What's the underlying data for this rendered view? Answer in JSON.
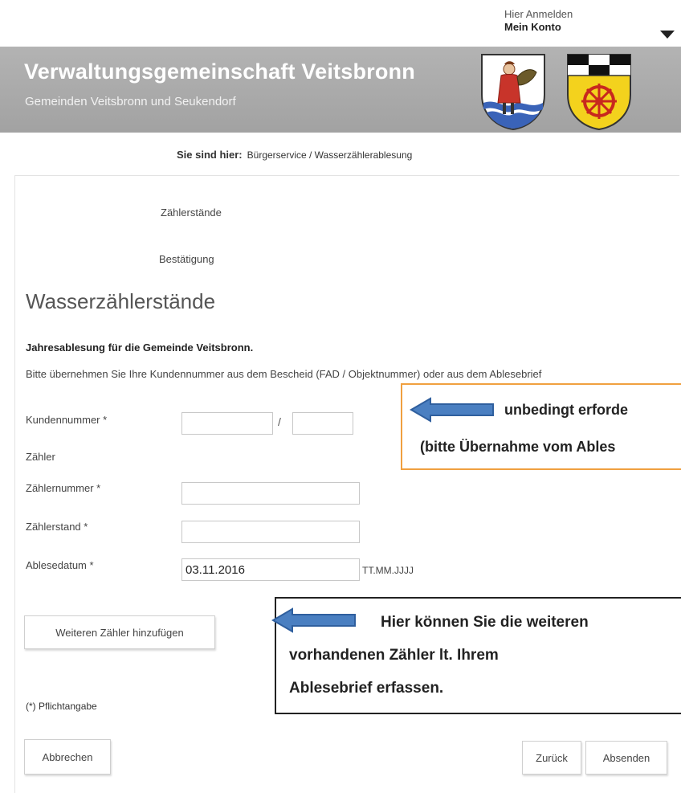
{
  "account": {
    "login_label": "Hier Anmelden",
    "konto_label": "Mein Konto"
  },
  "banner": {
    "title": "Verwaltungsgemeinschaft Veitsbronn",
    "subtitle": "Gemeinden Veitsbronn und Seukendorf"
  },
  "breadcrumb": {
    "label": "Sie sind hier:",
    "path": "Bürgerservice / Wasserzählerablesung"
  },
  "steps": [
    "Zählerstände",
    "Bestätigung"
  ],
  "form": {
    "title": "Wasserzählerstände",
    "subtitle": "Jahresablesung für die Gemeinde Veitsbronn.",
    "instructions": "Bitte übernehmen Sie Ihre Kundennummer aus dem Bescheid (FAD / Objektnummer) oder aus dem Ablesebrief",
    "kundennummer_label": "Kundennummer *",
    "kundennummer_separator": "/",
    "kundennummer_part1": "",
    "kundennummer_part2": "",
    "zaehler_section": "Zähler",
    "zaehlernummer_label": "Zählernummer *",
    "zaehlernummer_value": "",
    "zaehlerstand_label": "Zählerstand *",
    "zaehlerstand_value": "",
    "ablesedatum_label": "Ablesedatum *",
    "ablesedatum_value": "03.11.2016",
    "ablesedatum_hint": "TT.MM.JJJJ",
    "add_meter_button": "Weiteren Zähler hinzufügen",
    "required_note": "(*) Pflichtangabe",
    "cancel_button": "Abbrechen",
    "back_button": "Zurück",
    "submit_button": "Absenden"
  },
  "annotations": {
    "note1_line1": "unbedingt erforde",
    "note1_line2": "(bitte Übernahme vom Ables",
    "note2_line1": "Hier können Sie die weiteren",
    "note2_line2": "vorhandenen Zähler lt. Ihrem",
    "note2_line3": "Ablesebrief erfassen."
  },
  "colors": {
    "banner": "#a9a9a9",
    "arrow": "#4a7fc1",
    "note_orange": "#f0a040"
  },
  "icons": {
    "account_caret": "caret-down-icon",
    "crest_veitsbronn": "crest-veitsbronn-icon",
    "crest_seukendorf": "crest-seukendorf-icon",
    "arrow": "arrow-left-icon"
  }
}
